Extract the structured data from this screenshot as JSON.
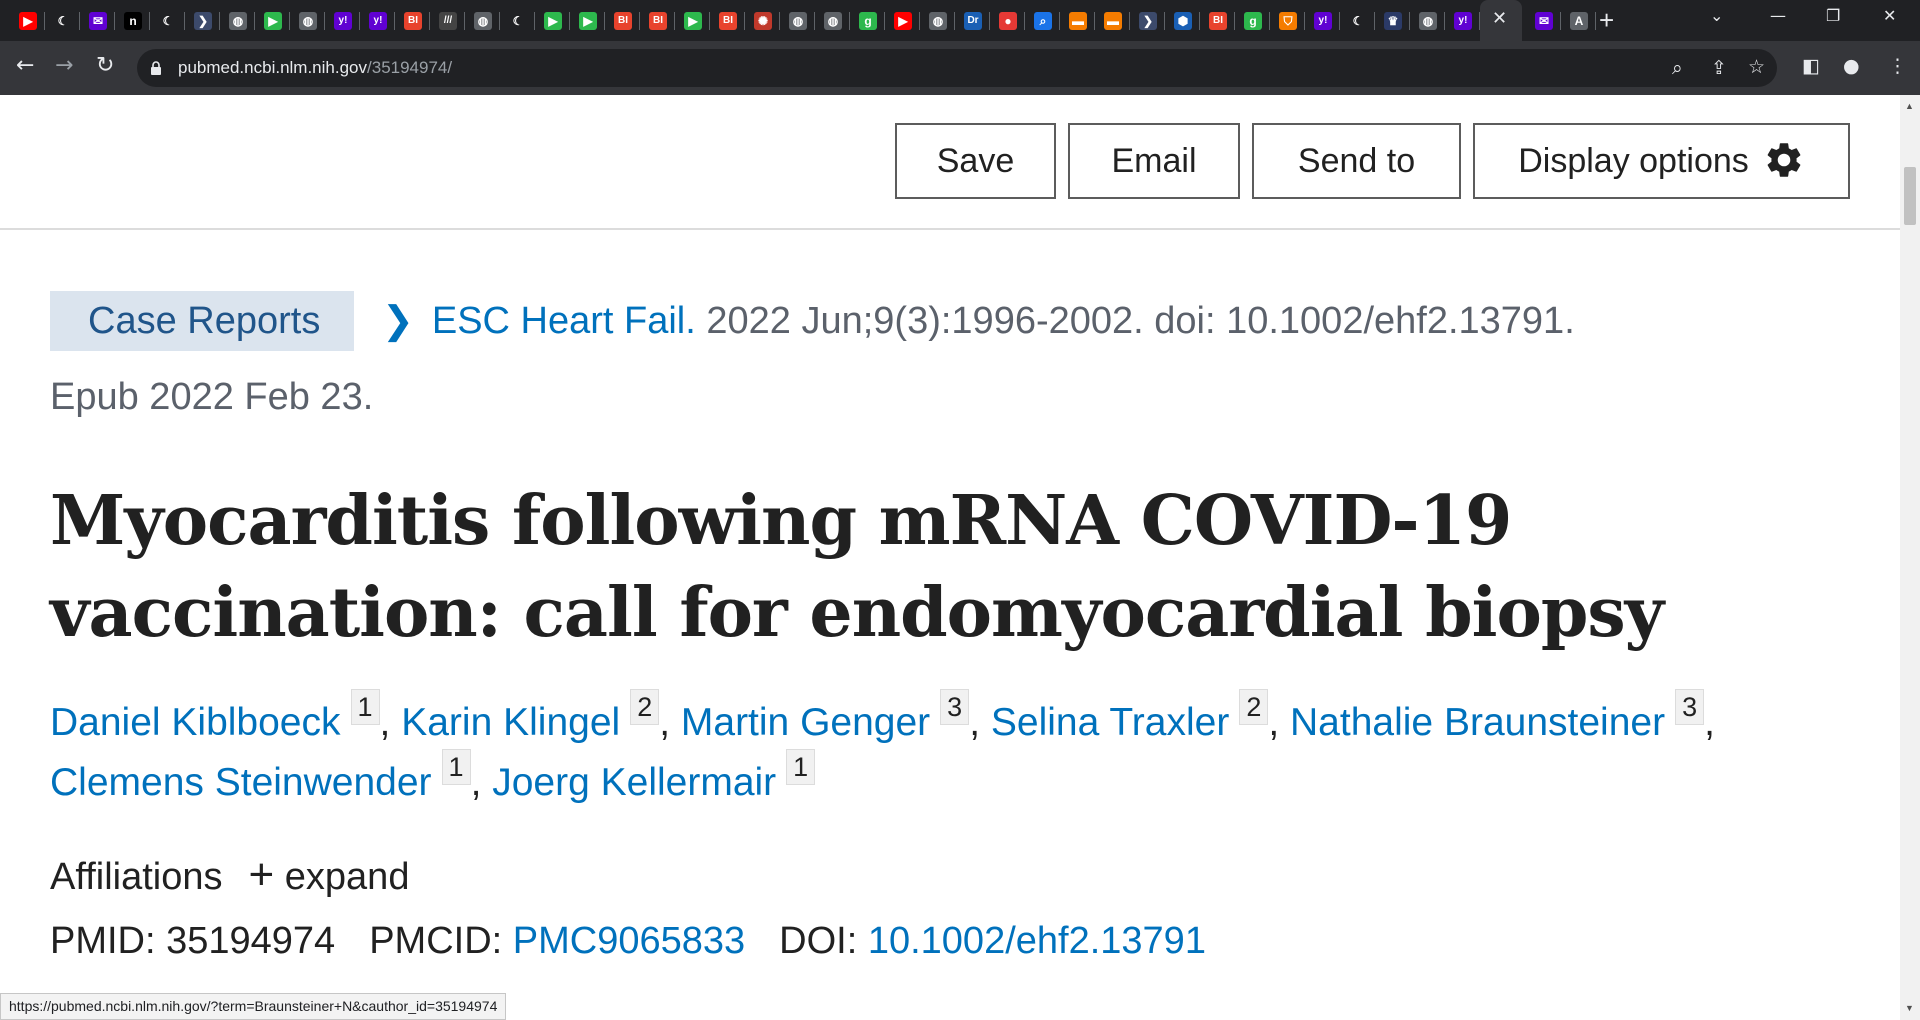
{
  "browser": {
    "tabs": [
      {
        "icon": "youtube-icon",
        "glyph": "▶",
        "color": "#ff0000"
      },
      {
        "icon": "crescent-icon",
        "glyph": "☾",
        "color": "#202124"
      },
      {
        "icon": "mail-icon",
        "glyph": "✉",
        "color": "#6001d2"
      },
      {
        "icon": "n-icon",
        "glyph": "n",
        "color": "#000000"
      },
      {
        "icon": "crescent-icon",
        "glyph": "☾",
        "color": "#202124"
      },
      {
        "icon": "arrow-icon",
        "glyph": "❯",
        "color": "#3c4a6b"
      },
      {
        "icon": "globe-icon",
        "glyph": "◍",
        "color": "#5f6368"
      },
      {
        "icon": "play-icon",
        "glyph": "▶",
        "color": "#2db84d"
      },
      {
        "icon": "globe-icon",
        "glyph": "◍",
        "color": "#5f6368"
      },
      {
        "icon": "yahoo-icon",
        "glyph": "y!",
        "color": "#6001d2"
      },
      {
        "icon": "yahoo-icon",
        "glyph": "y!",
        "color": "#6001d2"
      },
      {
        "icon": "bi-icon",
        "glyph": "BI",
        "color": "#e8432d"
      },
      {
        "icon": "stripes-icon",
        "glyph": "///",
        "color": "#444444"
      },
      {
        "icon": "globe-icon",
        "glyph": "◍",
        "color": "#5f6368"
      },
      {
        "icon": "crescent-icon",
        "glyph": "☾",
        "color": "#202124"
      },
      {
        "icon": "play-icon",
        "glyph": "▶",
        "color": "#2db84d"
      },
      {
        "icon": "play-icon",
        "glyph": "▶",
        "color": "#2db84d"
      },
      {
        "icon": "bi-icon",
        "glyph": "BI",
        "color": "#e8432d"
      },
      {
        "icon": "bi-icon",
        "glyph": "BI",
        "color": "#e8432d"
      },
      {
        "icon": "play-icon",
        "glyph": "▶",
        "color": "#2db84d"
      },
      {
        "icon": "bi-icon",
        "glyph": "BI",
        "color": "#e8432d"
      },
      {
        "icon": "burst-icon",
        "glyph": "✺",
        "color": "#c0392b"
      },
      {
        "icon": "globe-icon",
        "glyph": "◍",
        "color": "#5f6368"
      },
      {
        "icon": "globe-icon",
        "glyph": "◍",
        "color": "#5f6368"
      },
      {
        "icon": "g-icon",
        "glyph": "g",
        "color": "#2db84d"
      },
      {
        "icon": "youtube-icon",
        "glyph": "▶",
        "color": "#ff0000"
      },
      {
        "icon": "globe-icon",
        "glyph": "◍",
        "color": "#5f6368"
      },
      {
        "icon": "dr-icon",
        "glyph": "Dr",
        "color": "#1a5fb4"
      },
      {
        "icon": "mic-icon",
        "glyph": "●",
        "color": "#e53935"
      },
      {
        "icon": "search-icon",
        "glyph": "⌕",
        "color": "#1a73e8"
      },
      {
        "icon": "bookmark-icon",
        "glyph": "▬",
        "color": "#f57c00"
      },
      {
        "icon": "bookmark-icon",
        "glyph": "▬",
        "color": "#f57c00"
      },
      {
        "icon": "arrow-icon",
        "glyph": "❯",
        "color": "#3c4a6b"
      },
      {
        "icon": "cube-icon",
        "glyph": "⬢",
        "color": "#1a5fb4"
      },
      {
        "icon": "bi-icon",
        "glyph": "BI",
        "color": "#e8432d"
      },
      {
        "icon": "g-icon",
        "glyph": "g",
        "color": "#2db84d"
      },
      {
        "icon": "shield-icon",
        "glyph": "⛉",
        "color": "#f57c00"
      },
      {
        "icon": "yahoo-icon",
        "glyph": "y!",
        "color": "#6001d2"
      },
      {
        "icon": "crescent-icon",
        "glyph": "☾",
        "color": "#202124"
      },
      {
        "icon": "crest-icon",
        "glyph": "♛",
        "color": "#2b3a67"
      },
      {
        "icon": "globe-icon",
        "glyph": "◍",
        "color": "#5f6368"
      },
      {
        "icon": "yahoo-icon",
        "glyph": "y!",
        "color": "#6001d2"
      }
    ],
    "active_tab_close": "✕",
    "after_tabs": [
      {
        "icon": "mail-icon",
        "glyph": "✉",
        "color": "#6001d2"
      },
      {
        "icon": "a-icon",
        "glyph": "A",
        "color": "#5f6368"
      }
    ],
    "new_tab": "+",
    "url_host": "pubmed.ncbi.nlm.nih.gov",
    "url_path": "/35194974/",
    "status_url": "https://pubmed.ncbi.nlm.nih.gov/?term=Braunsteiner+N&cauthor_id=35194974"
  },
  "actions": {
    "save": "Save",
    "email": "Email",
    "send_to": "Send to",
    "display_options": "Display options"
  },
  "article": {
    "type": "Case Reports",
    "journal": "ESC Heart Fail.",
    "citation": " 2022 Jun;9(3):1996-2002. doi: 10.1002/ehf2.13791.",
    "epub": "Epub 2022 Feb 23.",
    "title": "Myocarditis following mRNA COVID‐19 vaccination: call for endomyocardial biopsy",
    "authors": [
      {
        "name": "Daniel Kiblboeck",
        "aff": "1"
      },
      {
        "name": "Karin Klingel",
        "aff": "2"
      },
      {
        "name": "Martin Genger",
        "aff": "3"
      },
      {
        "name": "Selina Traxler",
        "aff": "2"
      },
      {
        "name": "Nathalie Braunsteiner",
        "aff": "3"
      },
      {
        "name": "Clemens Steinwender",
        "aff": "1"
      },
      {
        "name": "Joerg Kellermair",
        "aff": "1"
      }
    ],
    "affiliations_label": "Affiliations",
    "expand_label": "expand",
    "pmid_label": "PMID:",
    "pmid": "35194974",
    "pmcid_label": "PMCID:",
    "pmcid": "PMC9065833",
    "doi_label": "DOI:",
    "doi": "10.1002/ehf2.13791"
  }
}
